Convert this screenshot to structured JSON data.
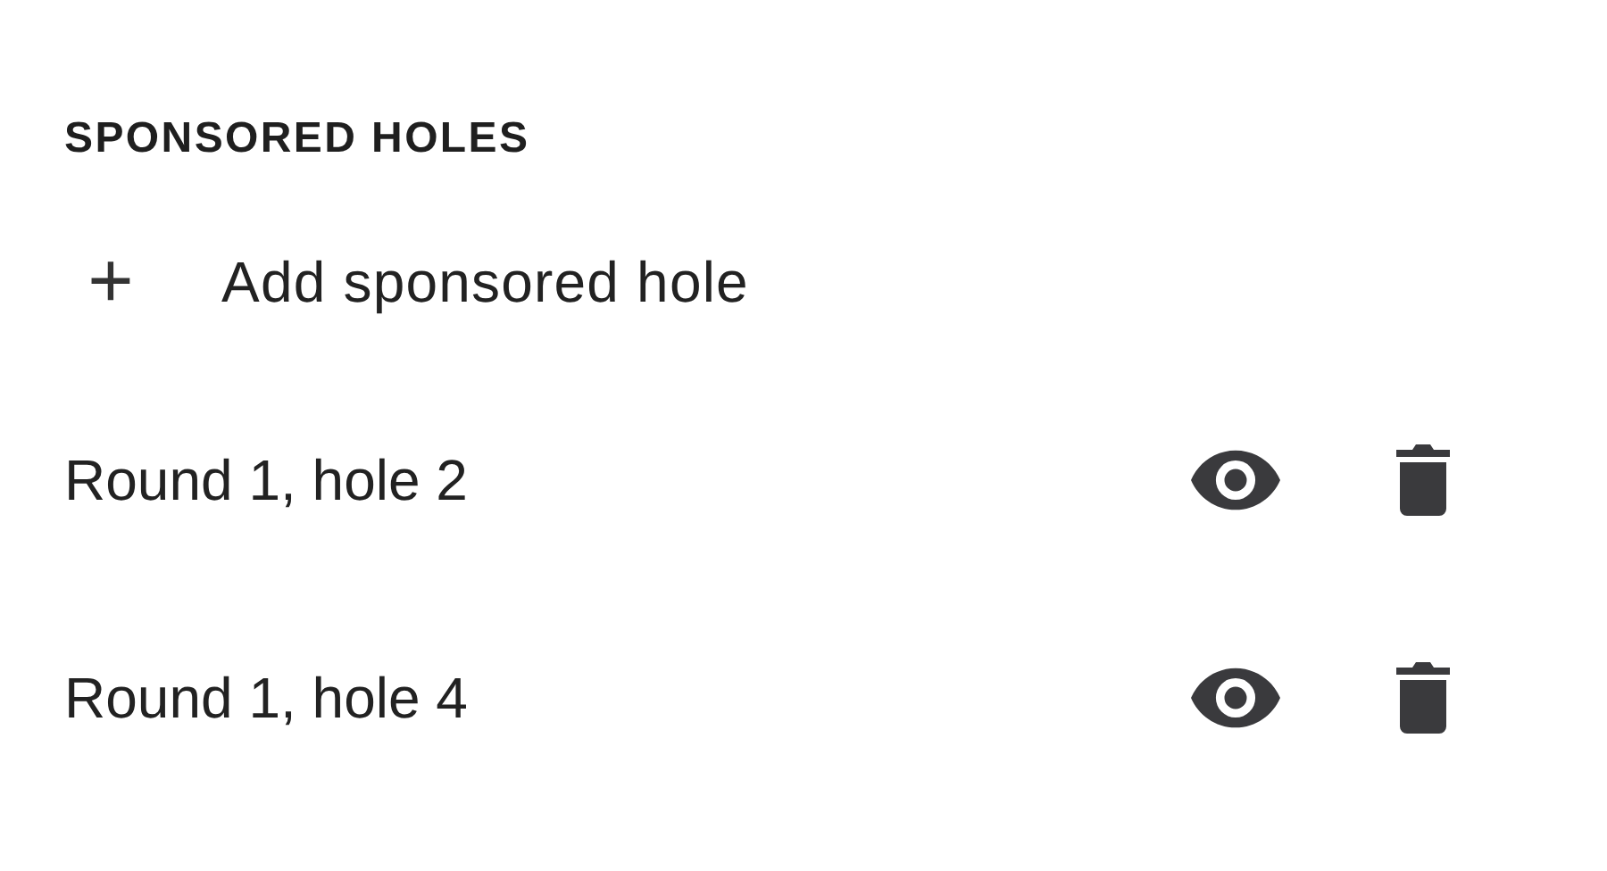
{
  "section": {
    "title": "SPONSORED HOLES"
  },
  "add_action": {
    "icon": "+",
    "label": "Add sponsored hole"
  },
  "holes": [
    {
      "label": "Round 1, hole 2"
    },
    {
      "label": "Round 1, hole 4"
    }
  ]
}
